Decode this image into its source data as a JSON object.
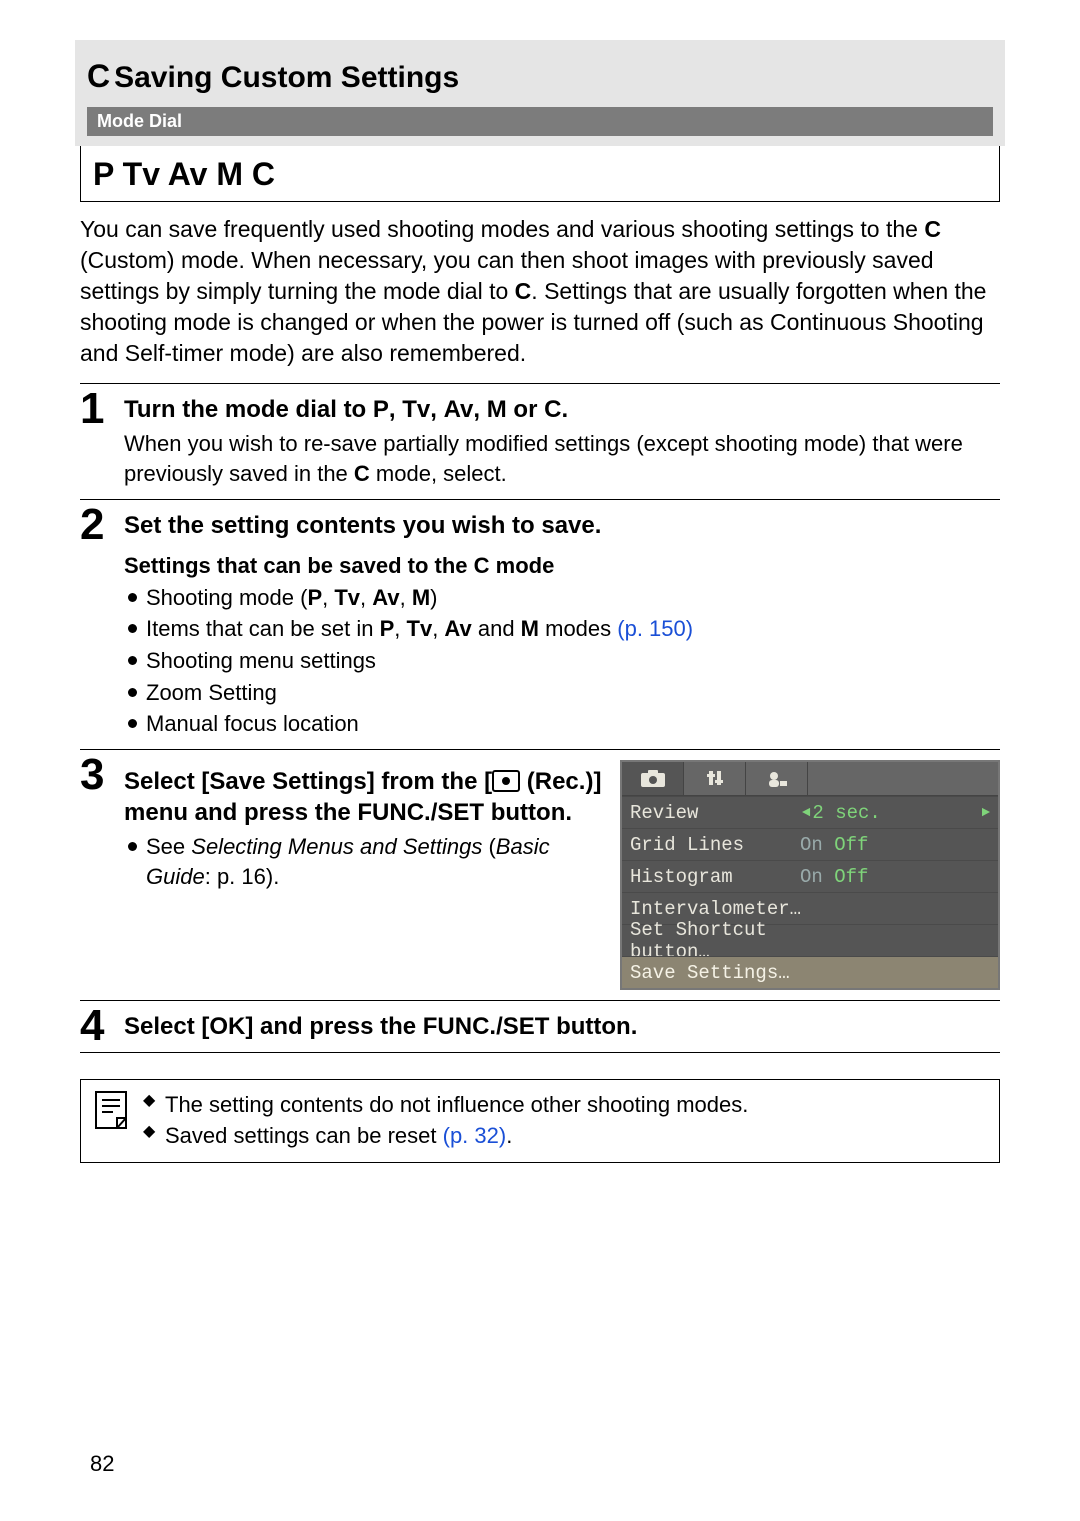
{
  "header": {
    "prefix": "C",
    "title": "Saving Custom Settings",
    "modedial_label": "Mode Dial",
    "modes": "P Tv Av M C"
  },
  "intro": {
    "p1a": "You can save frequently used shooting modes and various shooting settings to the ",
    "p1bold": "C",
    "p1b": " (Custom) mode. When necessary, you can then shoot images with previously saved settings by simply turning the mode dial to ",
    "p1bold2": "C",
    "p1c": ". Settings that are usually forgotten when the shooting mode is changed or when the power is turned off (such as Continuous Shooting and Self-timer mode) are also remembered."
  },
  "steps": {
    "s1": {
      "num": "1",
      "head_a": "Turn the mode dial to ",
      "head_b": "P",
      "head_c": ", ",
      "head_d": "Tv",
      "head_e": ", ",
      "head_f": "Av",
      "head_g": ", ",
      "head_h": "M",
      "head_i": " or ",
      "head_j": "C",
      "head_k": ".",
      "body_a": "When you wish to re-save partially modified settings (except shooting mode) that were previously saved in the ",
      "body_b": "C",
      "body_c": " mode, select."
    },
    "s2": {
      "num": "2",
      "head": "Set the setting contents you wish to save.",
      "subhead_a": "Settings that can be saved to the ",
      "subhead_b": "C",
      "subhead_c": " mode",
      "b1_a": "Shooting mode (",
      "b1_b": "P",
      "b1_c": ", ",
      "b1_d": "Tv",
      "b1_e": ", ",
      "b1_f": "Av",
      "b1_g": ", ",
      "b1_h": "M",
      "b1_i": ")",
      "b2_a": "Items that can be set in ",
      "b2_b": "P",
      "b2_c": ", ",
      "b2_d": "Tv",
      "b2_e": ", ",
      "b2_f": "Av",
      "b2_g": " and ",
      "b2_h": "M",
      "b2_i": " modes ",
      "b2_link": "(p. 150)",
      "b3": "Shooting menu settings",
      "b4": "Zoom Setting",
      "b5": "Manual focus location"
    },
    "s3": {
      "num": "3",
      "head_a": "Select [Save Settings] from the [",
      "head_b": " (Rec.)] menu and press the FUNC./SET button.",
      "bul_a": "See ",
      "bul_i": "Selecting Menus and Settings",
      "bul_b": " (",
      "bul_i2": "Basic Guide",
      "bul_c": ": p. 16)."
    },
    "s4": {
      "num": "4",
      "head": "Select [OK] and press the FUNC./SET button."
    }
  },
  "menu": {
    "rows": [
      {
        "label": "Review",
        "left_arrow": "◄",
        "val_sel": "2 sec.",
        "right_arrow": "►"
      },
      {
        "label": "Grid Lines",
        "dim": "On",
        "val_sel": "Off"
      },
      {
        "label": "Histogram",
        "dim": "On",
        "val_sel": "Off"
      },
      {
        "label": "Intervalometer…"
      },
      {
        "label": "Set Shortcut button…"
      },
      {
        "label": "Save Settings…",
        "highlight": true
      }
    ]
  },
  "notes": {
    "n1": "The setting contents do not influence other shooting modes.",
    "n2_a": "Saved settings can be reset ",
    "n2_link": "(p. 32)",
    "n2_b": "."
  },
  "page_number": "82"
}
